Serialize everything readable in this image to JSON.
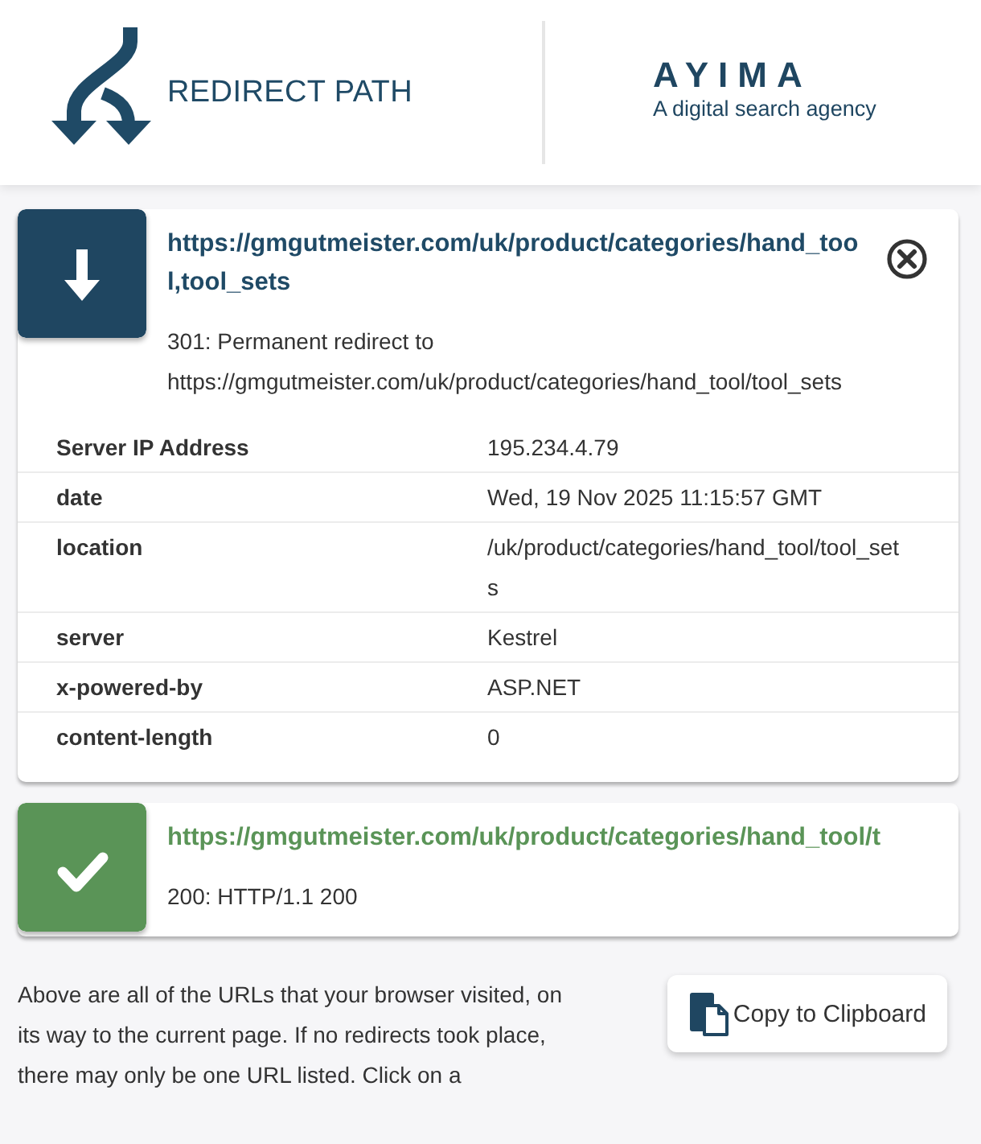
{
  "header": {
    "product": "REDIRECT PATH",
    "partner": "AYIMA",
    "partner_tagline": "A digital search agency"
  },
  "hops": [
    {
      "kind": "redirect",
      "url": "https://gmgutmeister.com/uk/product/categories/hand_tool,tool_sets",
      "status": "301: Permanent redirect to https://gmgutmeister.com/uk/product/categories/hand_tool/tool_sets",
      "expanded": true,
      "headers": [
        {
          "name": "Server IP Address",
          "value": "195.234.4.79"
        },
        {
          "name": "date",
          "value": "Wed, 19 Nov 2025 11:15:57 GMT"
        },
        {
          "name": "location",
          "value": "/uk/product/categories/hand_tool/tool_sets"
        },
        {
          "name": "server",
          "value": "Kestrel"
        },
        {
          "name": "x-powered-by",
          "value": "ASP.NET"
        },
        {
          "name": "content-length",
          "value": "0"
        }
      ]
    },
    {
      "kind": "ok",
      "url": "https://gmgutmeister.com/uk/product/categories/hand_tool/t",
      "status": "200: HTTP/1.1 200",
      "expanded": false
    }
  ],
  "footer": {
    "text": "Above are all of the URLs that your browser visited, on its way to the current page. If no redirects took place, there may only be one URL listed. Click on a",
    "copy_button": "Copy to Clipboard"
  }
}
